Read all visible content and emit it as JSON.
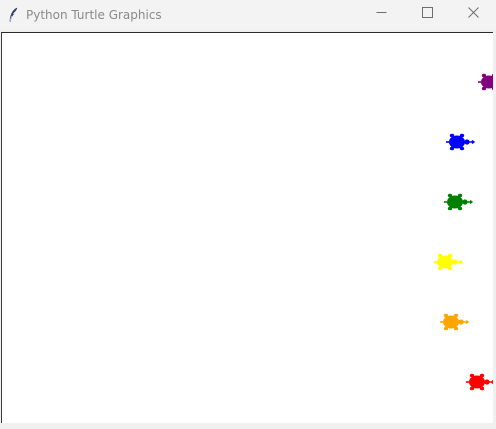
{
  "window": {
    "title": "Python Turtle Graphics",
    "icon": "feather-icon",
    "controls": {
      "minimize": "minimize-icon",
      "maximize": "maximize-icon",
      "close": "close-icon"
    }
  },
  "canvas": {
    "background": "#ffffff",
    "turtles": [
      {
        "name": "purple",
        "color": "#800080"
      },
      {
        "name": "blue",
        "color": "#0000ff"
      },
      {
        "name": "green",
        "color": "#008000"
      },
      {
        "name": "yellow",
        "color": "#ffff00"
      },
      {
        "name": "orange",
        "color": "#ffa500"
      },
      {
        "name": "red",
        "color": "#ff0000"
      }
    ]
  }
}
